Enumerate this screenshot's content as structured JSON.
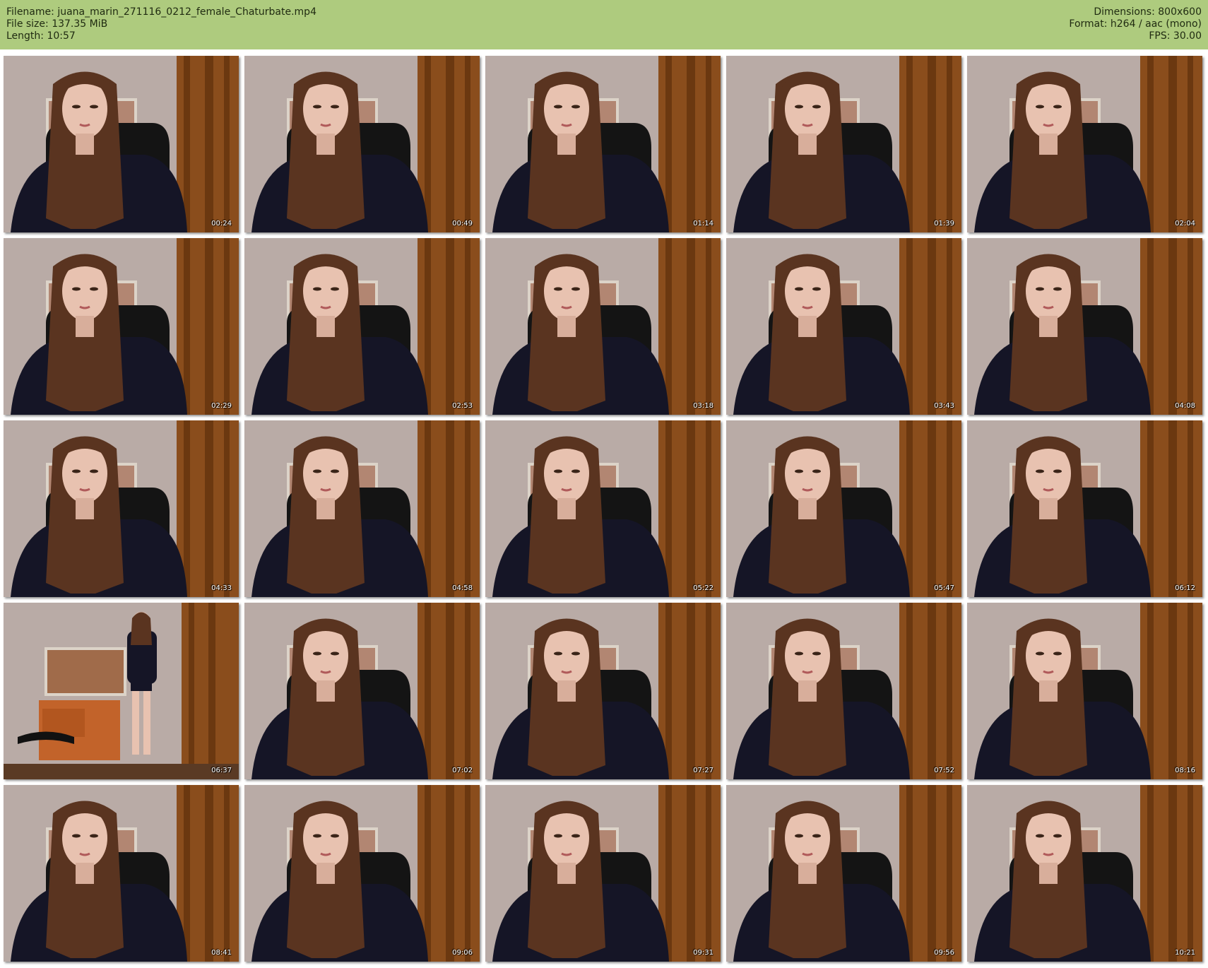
{
  "header": {
    "filename_label": "Filename:",
    "filename": "juana_marin_271116_0212_female_Chaturbate.mp4",
    "filesize_label": "File size:",
    "filesize": "137.35 MiB",
    "length_label": "Length:",
    "length": "10:57",
    "dimensions_label": "Dimensions:",
    "dimensions": "800x600",
    "format_label": "Format:",
    "format": "h264 / aac (mono)",
    "fps_label": "FPS:",
    "fps": "30.00"
  },
  "thumbnails": [
    {
      "timestamp": "00:24",
      "pose": "close"
    },
    {
      "timestamp": "00:49",
      "pose": "close"
    },
    {
      "timestamp": "01:14",
      "pose": "close"
    },
    {
      "timestamp": "01:39",
      "pose": "close"
    },
    {
      "timestamp": "02:04",
      "pose": "close"
    },
    {
      "timestamp": "02:29",
      "pose": "close"
    },
    {
      "timestamp": "02:53",
      "pose": "close"
    },
    {
      "timestamp": "03:18",
      "pose": "close"
    },
    {
      "timestamp": "03:43",
      "pose": "close"
    },
    {
      "timestamp": "04:08",
      "pose": "close"
    },
    {
      "timestamp": "04:33",
      "pose": "close"
    },
    {
      "timestamp": "04:58",
      "pose": "close"
    },
    {
      "timestamp": "05:22",
      "pose": "close"
    },
    {
      "timestamp": "05:47",
      "pose": "close"
    },
    {
      "timestamp": "06:12",
      "pose": "close"
    },
    {
      "timestamp": "06:37",
      "pose": "wide"
    },
    {
      "timestamp": "07:02",
      "pose": "close"
    },
    {
      "timestamp": "07:27",
      "pose": "close"
    },
    {
      "timestamp": "07:52",
      "pose": "close"
    },
    {
      "timestamp": "08:16",
      "pose": "close"
    },
    {
      "timestamp": "08:41",
      "pose": "close"
    },
    {
      "timestamp": "09:06",
      "pose": "close"
    },
    {
      "timestamp": "09:31",
      "pose": "close"
    },
    {
      "timestamp": "09:56",
      "pose": "close"
    },
    {
      "timestamp": "10:21",
      "pose": "close"
    }
  ],
  "colors": {
    "header_bg": "#aecb7e",
    "wall": "#b9aba6",
    "curtain": "#8a4d1c",
    "hair": "#5a3420",
    "shirt": "#151526",
    "skin": "#e8c2b0"
  }
}
